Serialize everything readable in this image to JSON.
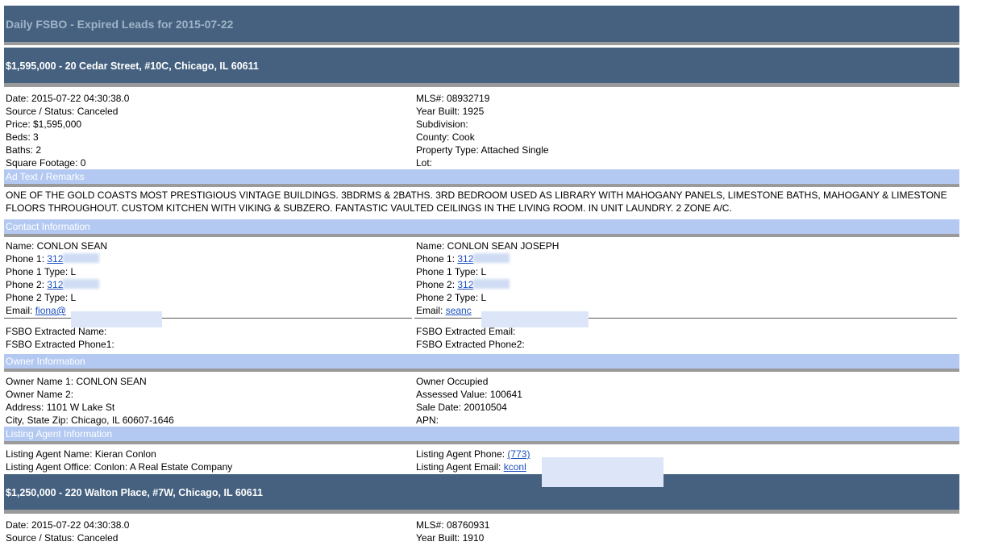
{
  "page_title": "Daily FSBO - Expired Leads for 2015-07-22",
  "listings": [
    {
      "header": "$1,595,000 - 20 Cedar Street, #10C, Chicago, IL 60611",
      "left_details": [
        "Date: 2015-07-22 04:30:38.0",
        "Source / Status: Canceled",
        "Price: $1,595,000",
        "Beds: 3",
        "Baths: 2",
        "Square Footage: 0"
      ],
      "right_details": [
        "MLS#: 08932719",
        "Year Built: 1925",
        "Subdivision:",
        "County: Cook",
        "Property Type: Attached Single",
        "Lot:"
      ],
      "ad_text_heading": "Ad Text / Remarks",
      "ad_text": "ONE OF THE GOLD COASTS MOST PRESTIGIOUS VINTAGE BUILDINGS. 3BDRMS & 2BATHS. 3RD BEDROOM USED AS LIBRARY WITH MAHOGANY PANELS, LIMESTONE BATHS, MAHOGANY & LIMESTONE FLOORS THROUGHOUT. CUSTOM KITCHEN WITH VIKING & SUBZERO. FANTASTIC VAULTED CEILINGS IN THE LIVING ROOM. IN UNIT LAUNDRY. 2 ZONE A/C.",
      "contact_heading": "Contact Information",
      "contact_left": {
        "name": "Name: CONLON SEAN",
        "phone1_label": "Phone 1: ",
        "phone1": "312",
        "phone1_type": "Phone 1 Type: L",
        "phone2_label": "Phone 2: ",
        "phone2": "312",
        "phone2_type": "Phone 2 Type: L",
        "email_label": "Email: ",
        "email": "fiona@"
      },
      "contact_right": {
        "name": "Name: CONLON SEAN JOSEPH",
        "phone1_label": "Phone 1: ",
        "phone1": "312",
        "phone1_type": "Phone 1 Type: L",
        "phone2_label": "Phone 2: ",
        "phone2": "312",
        "phone2_type": "Phone 2 Type: L",
        "email_label": "Email: ",
        "email": "seanc"
      },
      "fsbo_left": [
        "FSBO Extracted Name:",
        "FSBO Extracted Phone1:"
      ],
      "fsbo_right": [
        "FSBO Extracted Email:",
        "FSBO Extracted Phone2:"
      ],
      "owner_heading": "Owner Information",
      "owner_left": [
        "Owner Name 1: CONLON SEAN",
        "Owner Name 2:",
        "Address: 1101 W Lake St",
        "City, State Zip: Chicago, IL 60607-1646"
      ],
      "owner_right": [
        "Owner Occupied",
        "Assessed Value: 100641",
        "Sale Date: 20010504",
        "APN:"
      ],
      "agent_heading": "Listing Agent Information",
      "agent_name": "Listing Agent Name: Kieran Conlon",
      "agent_office": "Listing Agent Office: Conlon: A Real Estate Company",
      "agent_phone_label": "Listing Agent Phone: ",
      "agent_phone": "(773)",
      "agent_email_label": "Listing Agent Email: ",
      "agent_email": "kconl"
    },
    {
      "header": "$1,250,000 - 220 Walton Place, #7W, Chicago, IL 60611",
      "left_details": [
        "Date: 2015-07-22 04:30:38.0",
        "Source / Status: Canceled"
      ],
      "right_details": [
        "MLS#: 08760931",
        "Year Built: 1910"
      ]
    }
  ]
}
